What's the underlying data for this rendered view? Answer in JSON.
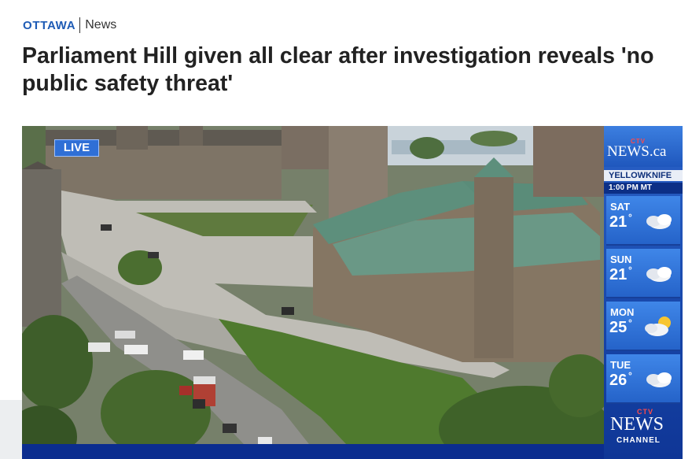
{
  "section": {
    "city": "OTTAWA",
    "name": "News"
  },
  "article": {
    "headline": "Parliament Hill given all clear after investigation reveals 'no public safety threat'"
  },
  "video": {
    "live_label": "LIVE",
    "brand": {
      "network": "CTV",
      "site": "NEWS.ca"
    },
    "weather": {
      "city": "YELLOWKNIFE",
      "time": "1:00 PM MT",
      "days": [
        {
          "day": "SAT",
          "temp": "21",
          "unit": "°",
          "icon": "cloud-icon"
        },
        {
          "day": "SUN",
          "temp": "21",
          "unit": "°",
          "icon": "cloud-icon"
        },
        {
          "day": "MON",
          "temp": "25",
          "unit": "°",
          "icon": "sun-cloud-icon"
        },
        {
          "day": "TUE",
          "temp": "26",
          "unit": "°",
          "icon": "cloud-icon"
        }
      ]
    },
    "channel_logo": {
      "network": "CTV",
      "name": "NEWS",
      "sub": "CHANNEL"
    }
  },
  "colors": {
    "accent_blue": "#1e5bb5",
    "headline": "#222222",
    "live_badge": "#2f6fd6",
    "weather_panel": "#1745a8"
  }
}
